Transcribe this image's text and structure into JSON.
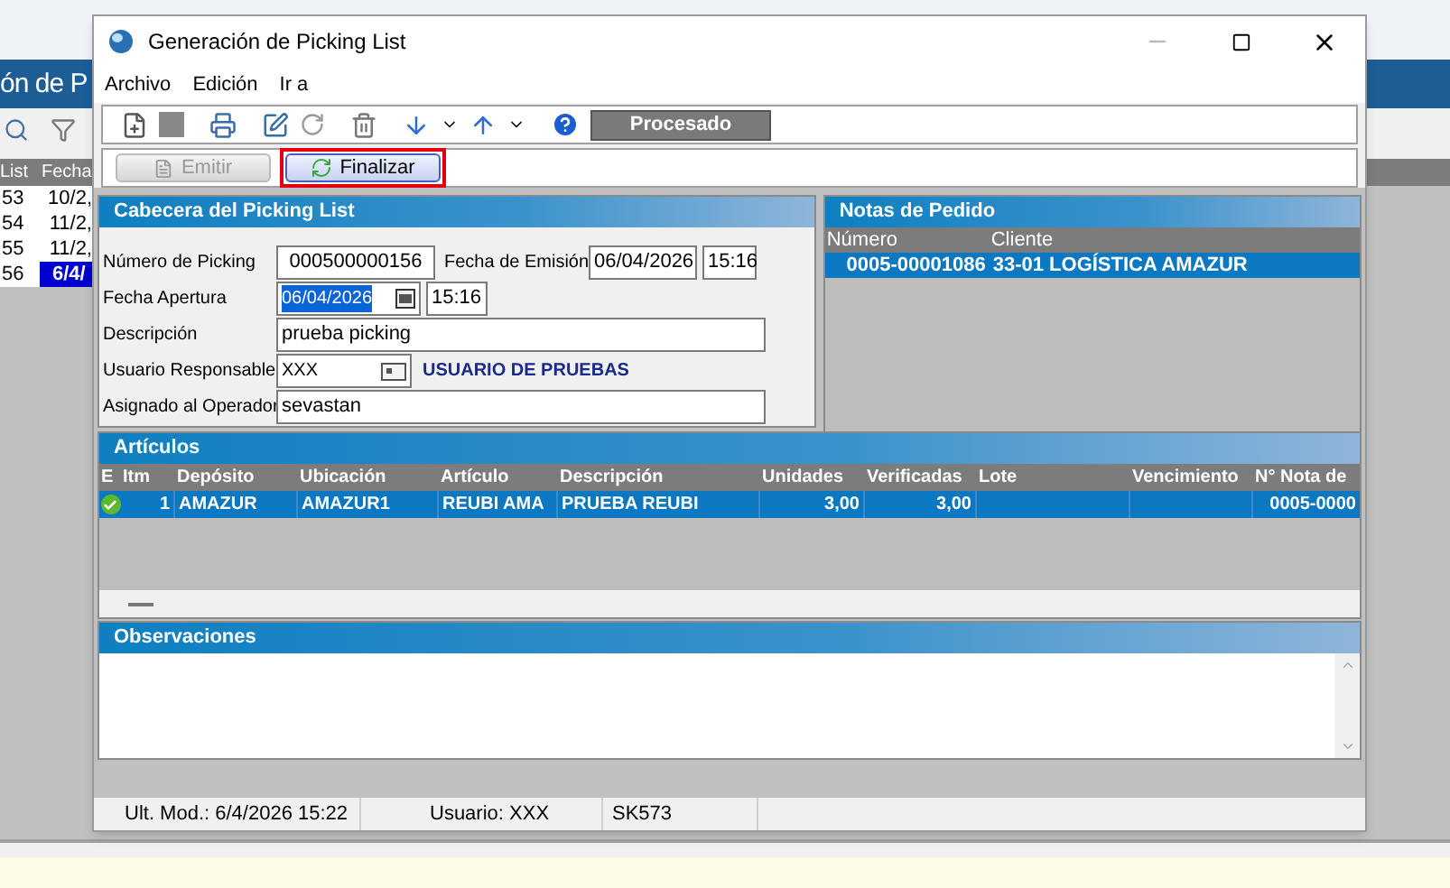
{
  "background": {
    "title": "ón de P",
    "list": {
      "columns": [
        "List",
        "Fecha"
      ],
      "rows": [
        {
          "cells": [
            "53",
            "10/2,"
          ],
          "selected": false
        },
        {
          "cells": [
            "54",
            "11/2,"
          ],
          "selected": false
        },
        {
          "cells": [
            "55",
            "11/2,"
          ],
          "selected": false
        },
        {
          "cells": [
            "56",
            "6/4/"
          ],
          "selected": true
        }
      ]
    }
  },
  "window": {
    "title": "Generación de Picking List"
  },
  "menu": [
    "Archivo",
    "Edición",
    "Ir a"
  ],
  "toolbar": {
    "status": "Procesado"
  },
  "actions": [
    {
      "label": "Emitir",
      "disabled": true,
      "highlighted": false
    },
    {
      "label": "Finalizar",
      "disabled": false,
      "highlighted": true
    }
  ],
  "header_panel": {
    "title": "Cabecera del Picking List",
    "numero": {
      "label": "Número de Picking",
      "value": "000500000156"
    },
    "emision": {
      "label": "Fecha de Emisión",
      "date": "06/04/2026",
      "time": "15:16"
    },
    "apertura": {
      "label": "Fecha Apertura",
      "date": "06/04/2026",
      "time": "15:16",
      "selected": true
    },
    "descripcion": {
      "label": "Descripción",
      "value": "prueba picking"
    },
    "usuario": {
      "label": "Usuario Responsable",
      "value": "XXX",
      "name": "USUARIO DE PRUEBAS"
    },
    "operador": {
      "label": "Asignado al Operador",
      "value": "sevastan"
    }
  },
  "notas": {
    "title": "Notas de Pedido",
    "columns": [
      "Número",
      "Cliente"
    ],
    "rows": [
      {
        "cells": [
          "0005-00001086",
          "33-01 LOGÍSTICA AMAZUR"
        ],
        "selected": true
      }
    ]
  },
  "articulos": {
    "title": "Artículos",
    "status_column": "E",
    "columns": [
      "Itm",
      "Depósito",
      "Ubicación",
      "Artículo",
      "Descripción",
      "Unidades",
      "Verificadas",
      "Lote",
      "Vencimiento",
      "N° Nota de"
    ],
    "rows": [
      {
        "checked": true,
        "selected": true,
        "cells": [
          "1",
          "AMAZUR",
          "AMAZUR1",
          "REUBI AMA",
          "PRUEBA REUBI",
          "3,00",
          "3,00",
          "",
          "",
          "0005-0000"
        ]
      }
    ]
  },
  "observaciones": {
    "title": "Observaciones"
  },
  "status_bar": [
    "Ult. Mod.: 6/4/2026 15:22",
    "Usuario: XXX",
    "SK573"
  ]
}
